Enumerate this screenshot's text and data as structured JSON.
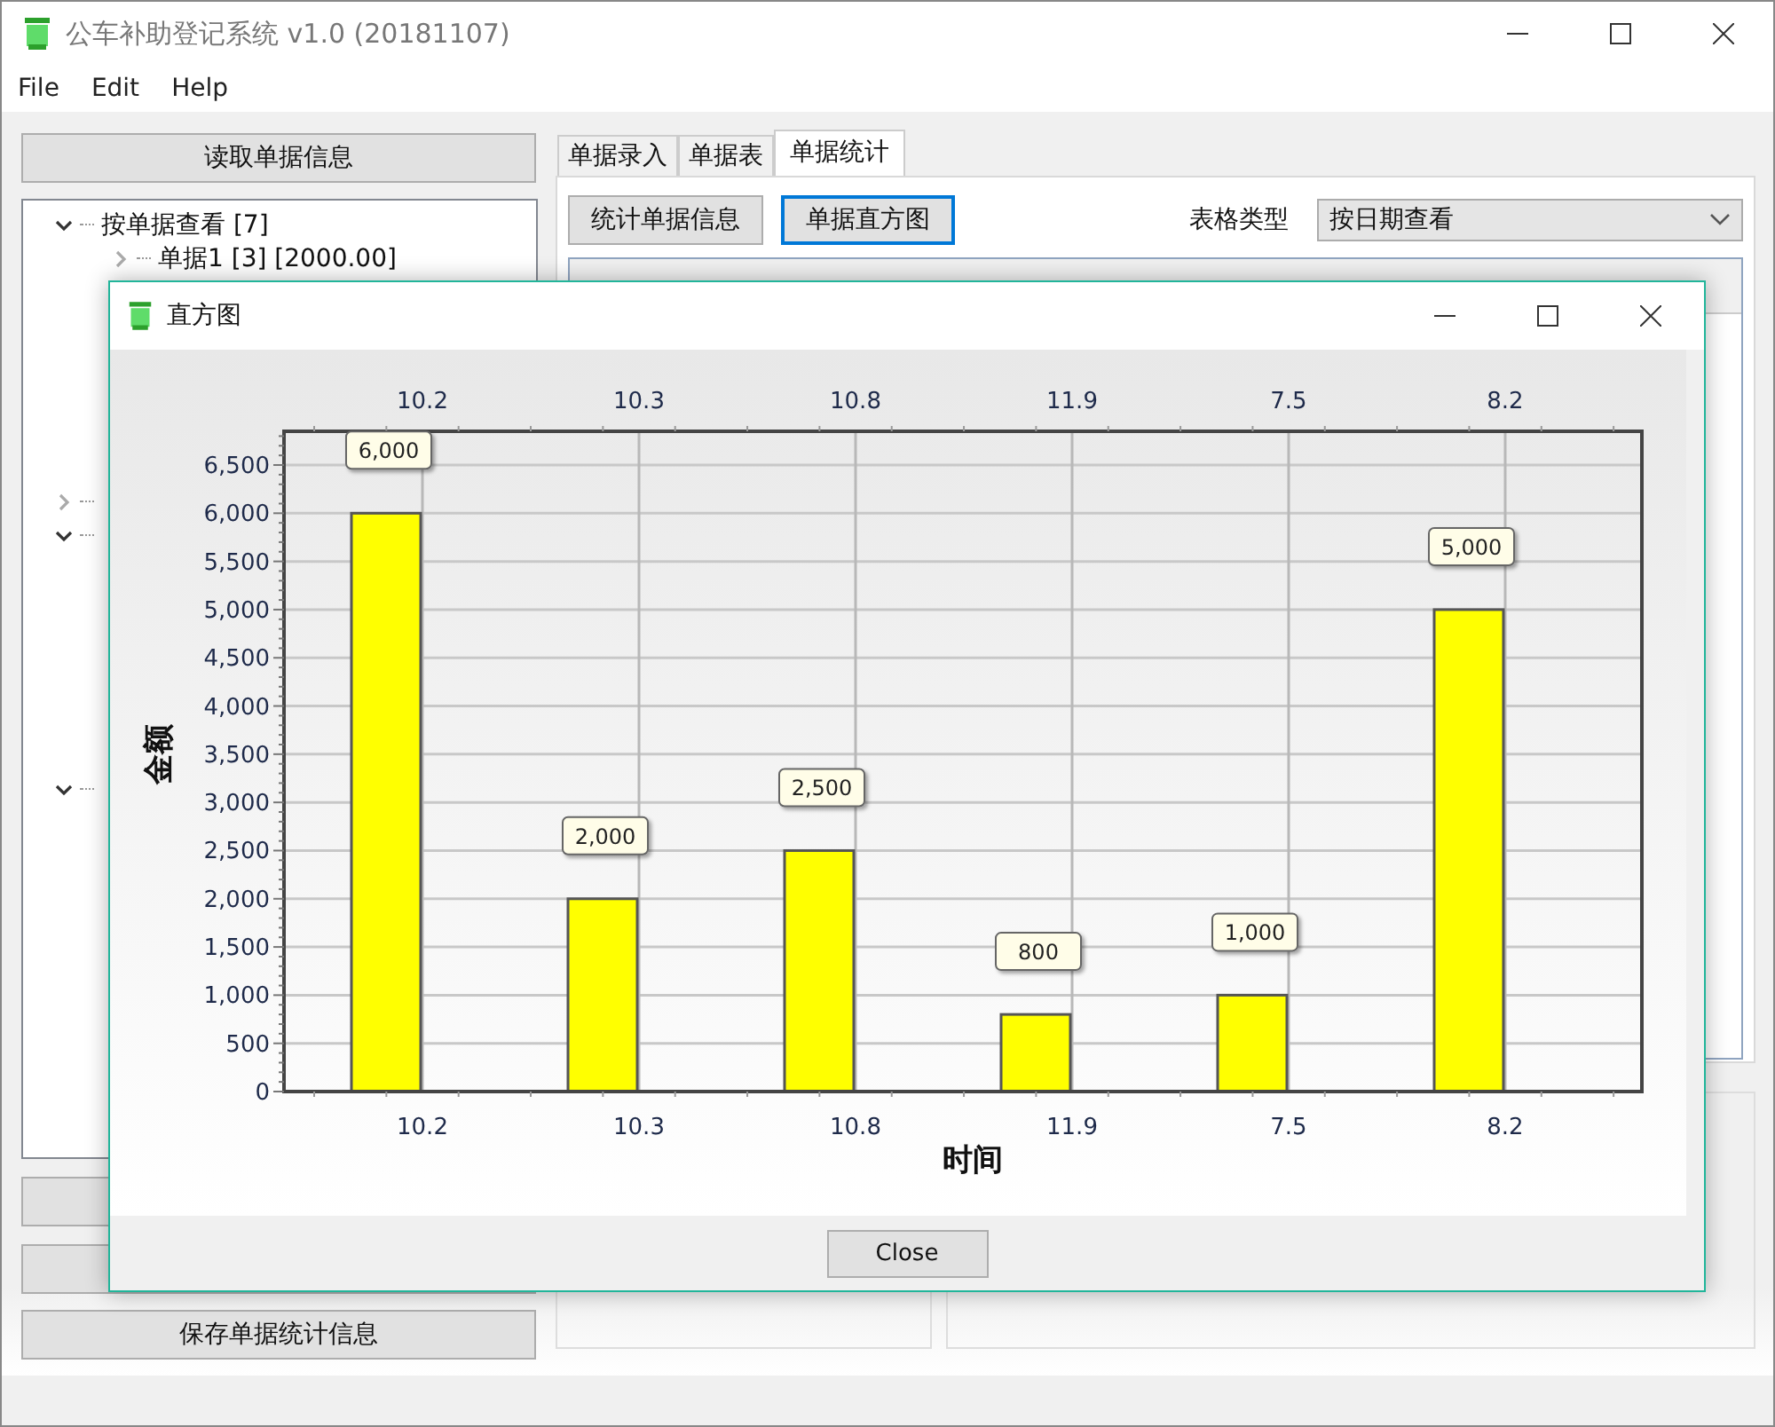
{
  "window": {
    "title": "公车补助登记系统 v1.0 (20181107)"
  },
  "menu": [
    "File",
    "Edit",
    "Help"
  ],
  "left_panel": {
    "read_button": "读取单据信息",
    "tree": [
      {
        "label": "按单据查看 [7]",
        "expanded": true,
        "children": [
          {
            "label": "单据1 [3] [2000.00]",
            "expanded": false
          }
        ]
      },
      {
        "expanded": false
      },
      {
        "expanded": true
      },
      {
        "expanded": true
      }
    ],
    "save_button": "保存单据统计信息"
  },
  "tabs": [
    {
      "label": "单据录入",
      "selected": false
    },
    {
      "label": "单据表",
      "selected": false
    },
    {
      "label": "单据统计",
      "selected": true
    }
  ],
  "toolbar": {
    "buttons": [
      {
        "label": "统计单据信息",
        "focused": false
      },
      {
        "label": "单据直方图",
        "focused": true
      }
    ],
    "table_type_label": "表格类型",
    "table_type_value": "按日期查看"
  },
  "dialog": {
    "title": "直方图",
    "close_button": "Close",
    "chart_data": {
      "type": "bar",
      "xlabel": "时间",
      "ylabel": "金额",
      "categories": [
        "10.2",
        "10.3",
        "10.8",
        "11.9",
        "7.5",
        "8.2"
      ],
      "series": [
        {
          "color": "#ffff00",
          "values": [
            6000,
            2000,
            2500,
            800,
            1000,
            5000
          ]
        }
      ],
      "ylim": [
        0,
        6850
      ],
      "yticks": [
        0,
        500,
        {
          "value": 1000,
          "label": "1,000"
        },
        {
          "value": 1500,
          "label": "1,500"
        },
        {
          "value": 2000,
          "label": "2,000"
        },
        {
          "value": 2500,
          "label": "2,500"
        },
        {
          "value": 3000,
          "label": "3,000"
        },
        {
          "value": 3500,
          "label": "3,500"
        },
        {
          "value": 4000,
          "label": "4,000"
        },
        {
          "value": 4500,
          "label": "4,500"
        },
        {
          "value": 5000,
          "label": "5,000"
        },
        {
          "value": 5500,
          "label": "5,500"
        },
        {
          "value": 6000,
          "label": "6,000"
        },
        {
          "value": 6500,
          "label": "6,500"
        }
      ],
      "grid": true,
      "value_labels": [
        "6,000",
        "2,000",
        "2,500",
        "800",
        "1,000",
        "5,000"
      ]
    }
  }
}
